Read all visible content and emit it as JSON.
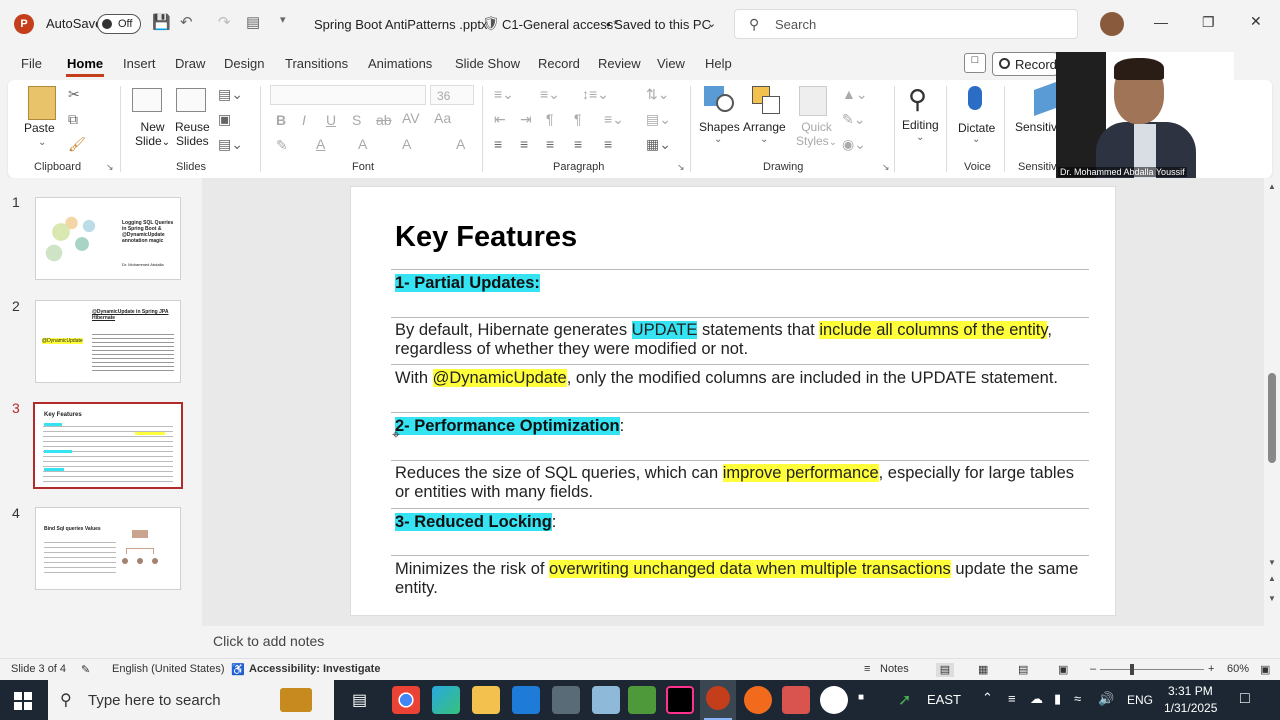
{
  "titlebar": {
    "autosave_label": "AutoSave",
    "autosave_state": "Off",
    "document_title": "Spring Boot AntiPatterns .pptx",
    "sensitivity": "C1-General access*",
    "save_status": "• Saved to this PC",
    "search_placeholder": "Search"
  },
  "menu": {
    "tabs": [
      "File",
      "Home",
      "Insert",
      "Draw",
      "Design",
      "Transitions",
      "Animations",
      "Slide Show",
      "Record",
      "Review",
      "View",
      "Help"
    ],
    "record_button": "Record"
  },
  "ribbon": {
    "groups": {
      "clipboard": "Clipboard",
      "slides": "Slides",
      "font": "Font",
      "paragraph": "Paragraph",
      "drawing": "Drawing",
      "voice": "Voice",
      "sensitivity": "Sensitivi"
    },
    "paste": "Paste",
    "new_slide": [
      "New",
      "Slide"
    ],
    "reuse_slides": [
      "Reuse",
      "Slides"
    ],
    "font_size": "36",
    "shapes": "Shapes",
    "arrange": "Arrange",
    "quick_styles": [
      "Quick",
      "Styles"
    ],
    "editing": "Editing",
    "dictate": "Dictate",
    "sensitivity_btn": "Sensitiv"
  },
  "webcam": {
    "name": "Dr. Mohammed Abdalla Youssif"
  },
  "slides_panel": {
    "numbers": [
      "1",
      "2",
      "3",
      "4"
    ],
    "thumb1": {
      "title": "Logging SQL Queries in Spring Boot & @DynamicUpdate annotation magic",
      "author": "Dr. Mohammed Abdalla"
    },
    "thumb2": {
      "title": "@DynamicUpdate in Spring JPA Hibernate",
      "tag": "@DynamicUpdate"
    },
    "thumb3": {
      "title": "Key Features"
    },
    "thumb4": {
      "title": "Bind Sql queries Values"
    }
  },
  "slide": {
    "title": "Key Features",
    "h1": "1- Partial Updates:",
    "p1": {
      "a": "By default, Hibernate generates ",
      "b": "UPDATE",
      "c": " statements that ",
      "d": "include all columns of the entity",
      "e": ", regardless of whether they were modified or not."
    },
    "p2": {
      "a": "With ",
      "b": "@DynamicUpdate",
      "c": ", only the modified columns are included in the UPDATE statement."
    },
    "h2": "2- Performance Optimization",
    "h2_suffix": ":",
    "p3": {
      "a": "Reduces the size of SQL queries, which can ",
      "b": "improve performance",
      "c": ", especially for large tables or entities with many fields."
    },
    "h3": "3- Reduced Locking",
    "h3_suffix": ":",
    "p4": {
      "a": "Minimizes the risk of ",
      "b": "overwriting unchanged data when multiple transactions",
      "c": " update the same entity."
    }
  },
  "notes_placeholder": "Click to add notes",
  "status": {
    "slide_count": "Slide 3 of 4",
    "language": "English (United States)",
    "accessibility": "Accessibility: Investigate",
    "notes": "Notes",
    "zoom": "60%"
  },
  "taskbar": {
    "search_placeholder": "Type here to search",
    "weather": "EAST",
    "lang": "ENG",
    "time": "3:31 PM",
    "date": "1/31/2025"
  }
}
